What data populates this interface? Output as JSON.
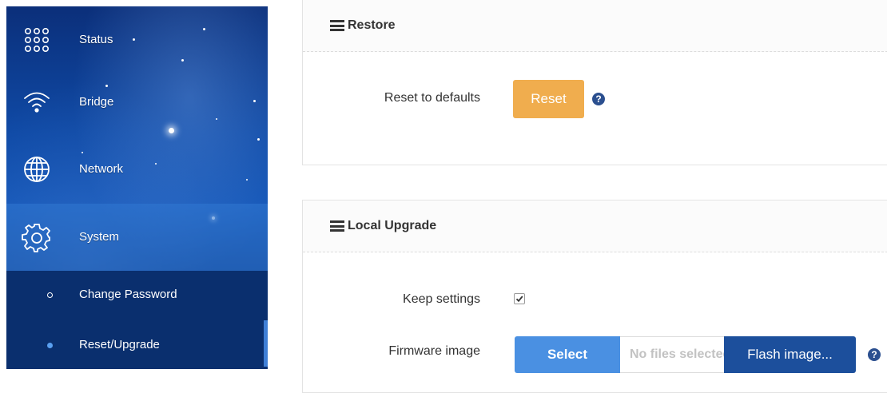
{
  "sidebar": {
    "items": [
      {
        "label": "Status",
        "icon": "dots-grid-icon"
      },
      {
        "label": "Bridge",
        "icon": "wifi-icon"
      },
      {
        "label": "Network",
        "icon": "globe-icon"
      },
      {
        "label": "System",
        "icon": "gear-icon"
      }
    ],
    "sub_items": [
      {
        "label": "Change Password"
      },
      {
        "label": "Reset/Upgrade"
      }
    ]
  },
  "restore": {
    "title": "Restore",
    "reset_label": "Reset to defaults",
    "reset_button": "Reset"
  },
  "upgrade": {
    "title": "Local Upgrade",
    "keep_settings_label": "Keep settings",
    "keep_settings_checked": true,
    "firmware_label": "Firmware image",
    "select_button": "Select",
    "no_file_text": "No files selected",
    "flash_button": "Flash image..."
  },
  "colors": {
    "sidebar_blue": "#0f4aa6",
    "reset_orange": "#f0ad4e",
    "select_blue": "#4a90e2",
    "flash_blue": "#1c4f9c",
    "help_icon": "#2b4f8f"
  }
}
